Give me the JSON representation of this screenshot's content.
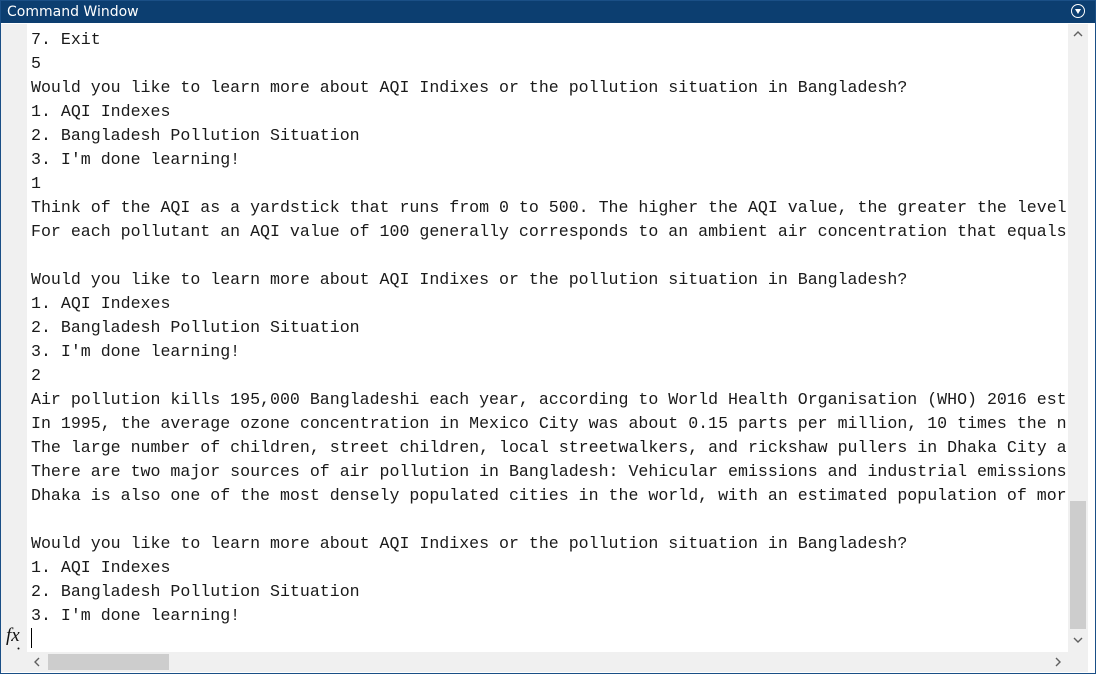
{
  "window": {
    "title": "Command Window",
    "menu_icon": "chevron-down-circle-icon"
  },
  "prompt": {
    "symbol": "fx"
  },
  "output_lines": [
    "7. Exit",
    "5",
    "Would you like to learn more about AQI Indixes or the pollution situation in Bangladesh?",
    "1. AQI Indexes",
    "2. Bangladesh Pollution Situation",
    "3. I'm done learning!",
    "1",
    "Think of the AQI as a yardstick that runs from 0 to 500. The higher the AQI value, the greater the level",
    "For each pollutant an AQI value of 100 generally corresponds to an ambient air concentration that equals",
    "",
    "Would you like to learn more about AQI Indixes or the pollution situation in Bangladesh?",
    "1. AQI Indexes",
    "2. Bangladesh Pollution Situation",
    "3. I'm done learning!",
    "2",
    "Air pollution kills 195,000 Bangladeshi each year, according to World Health Organisation (WHO) 2016 est",
    "In 1995, the average ozone concentration in Mexico City was about 0.15 parts per million, 10 times the n",
    "The large number of children, street children, local streetwalkers, and rickshaw pullers in Dhaka City a",
    "There are two major sources of air pollution in Bangladesh: Vehicular emissions and industrial emissions",
    "Dhaka is also one of the most densely populated cities in the world, with an estimated population of mor",
    "",
    "Would you like to learn more about AQI Indixes or the pollution situation in Bangladesh?",
    "1. AQI Indexes",
    "2. Bangladesh Pollution Situation",
    "3. I'm done learning!"
  ],
  "scrollbars": {
    "vertical": {
      "up_arrow": "^",
      "down_arrow": "v",
      "position_fraction": 0.76
    },
    "horizontal": {
      "left_arrow": "<",
      "right_arrow": ">",
      "position_fraction": 0.0
    }
  },
  "colors": {
    "titlebar": "#0c3e70",
    "text": "#1a1a1a",
    "scroll_thumb": "#cdcdcd"
  }
}
